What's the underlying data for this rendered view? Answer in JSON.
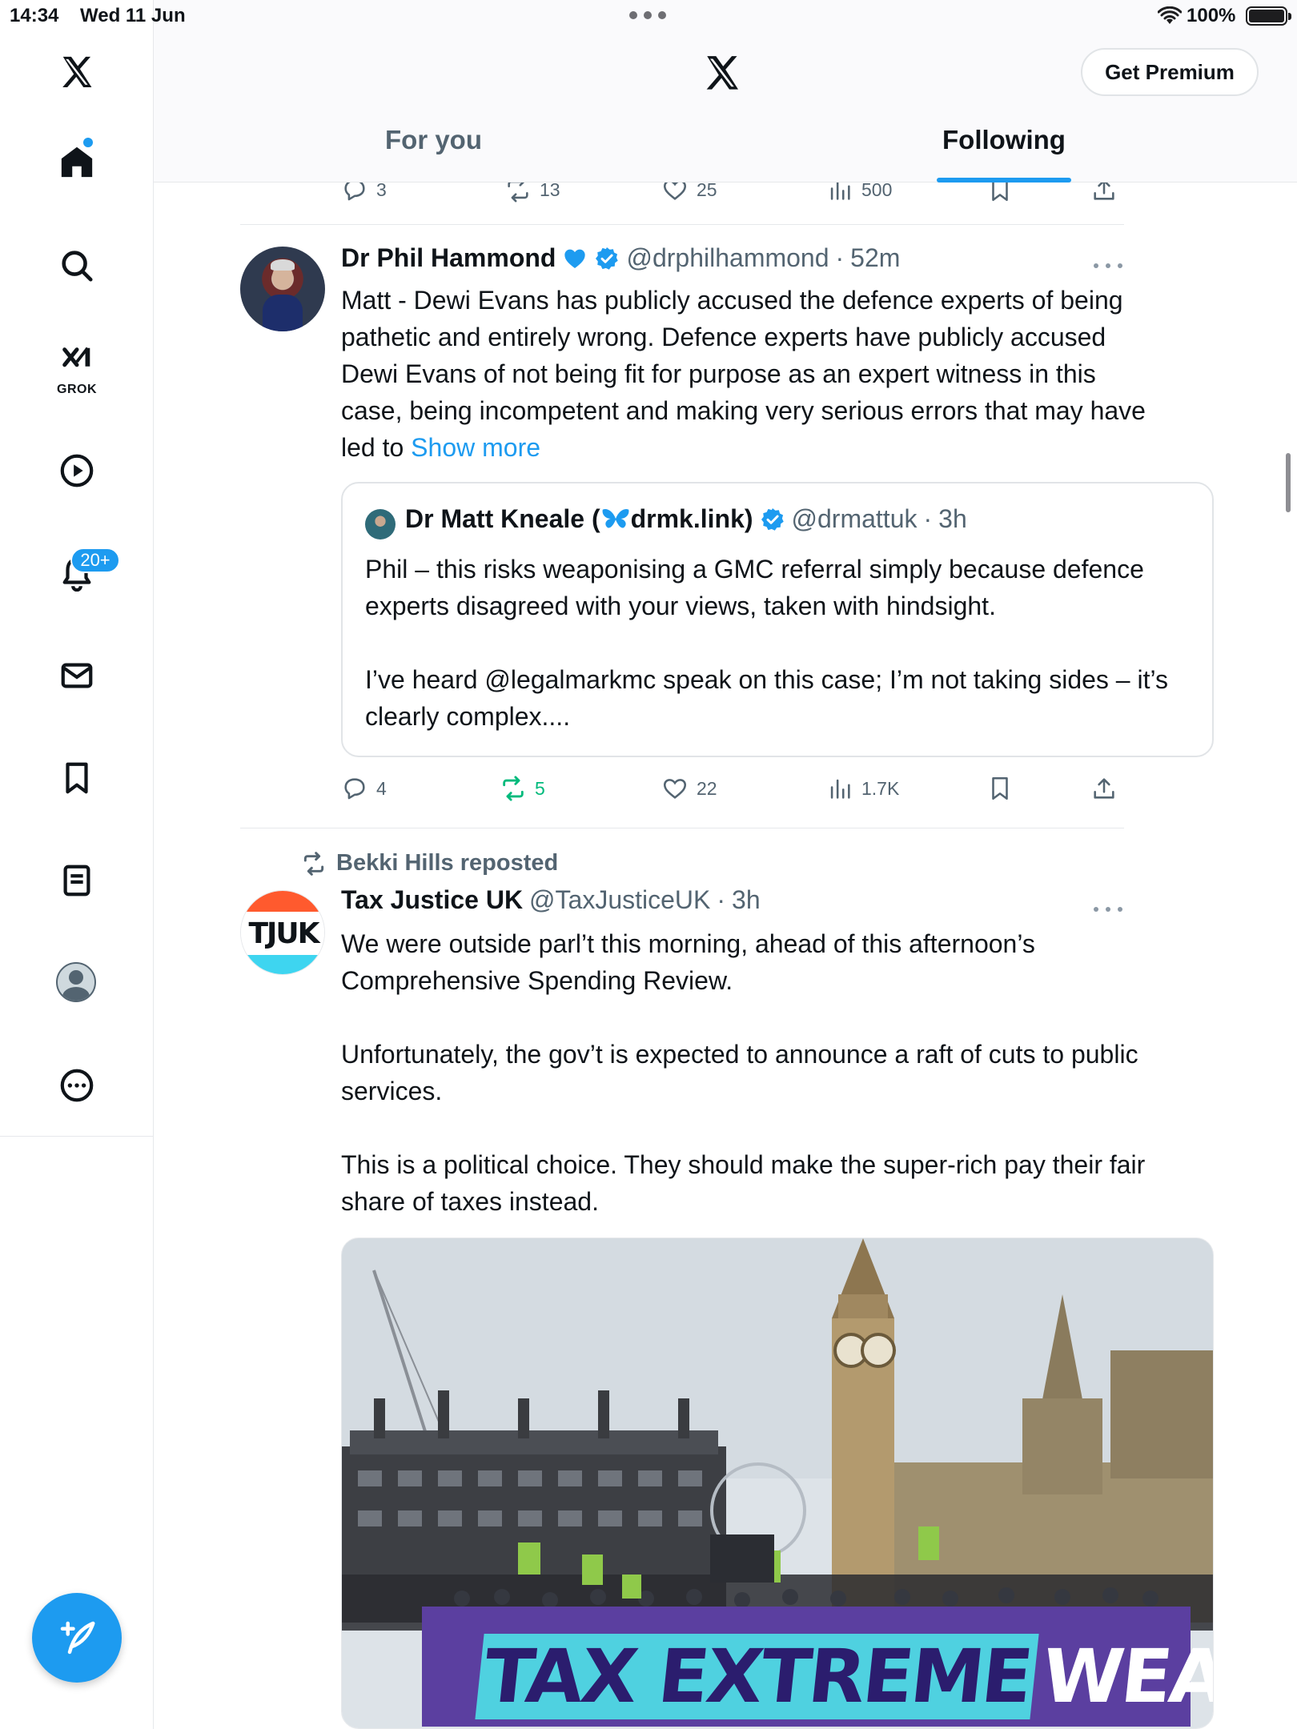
{
  "status_bar": {
    "time": "14:34",
    "date": "Wed 11 Jun",
    "battery_percent": "100%"
  },
  "header": {
    "premium_button": "Get Premium",
    "tabs": [
      {
        "label": "For you",
        "active": false
      },
      {
        "label": "Following",
        "active": true
      }
    ]
  },
  "sidebar": {
    "items": [
      {
        "name": "home",
        "icon": "home-icon"
      },
      {
        "name": "explore",
        "icon": "search-icon"
      },
      {
        "name": "grok",
        "icon": "grok-icon",
        "label": "GROK"
      },
      {
        "name": "videos",
        "icon": "play-icon"
      },
      {
        "name": "notifications",
        "icon": "bell-icon",
        "badge": "20+"
      },
      {
        "name": "messages",
        "icon": "mail-icon"
      },
      {
        "name": "bookmarks",
        "icon": "bookmark-icon"
      },
      {
        "name": "lists",
        "icon": "list-icon"
      },
      {
        "name": "profile",
        "icon": "avatar"
      },
      {
        "name": "more",
        "icon": "more-icon"
      }
    ],
    "compose": "compose-icon"
  },
  "feed": {
    "partial_post_actions": {
      "replies": "3",
      "reposts": "13",
      "likes": "25",
      "views": "500"
    },
    "posts": [
      {
        "name": "Dr Phil Hammond",
        "handle": "@drphilhammond",
        "time": "52m",
        "text": "Matt - Dewi Evans has publicly accused the defence experts of being pathetic and entirely wrong. Defence experts have publicly accused Dewi Evans of not being fit for purpose as an expert witness in this case, being incompetent and making very serious errors that may have led to ",
        "show_more": "Show more",
        "quote": {
          "name_part1": "Dr Matt Kneale (",
          "name_part2": "drmk.link)",
          "handle": "@drmattuk",
          "time": "3h",
          "text": "Phil – this risks weaponising a GMC referral simply because defence experts disagreed with your views, taken with hindsight.\n\nI’ve heard @legalmarkmc speak on this case; I’m not taking sides – it’s clearly complex...."
        },
        "actions": {
          "replies": "4",
          "reposts": "5",
          "likes": "22",
          "views": "1.7K"
        }
      },
      {
        "reposted_by": "Bekki Hills reposted",
        "name": "Tax Justice UK",
        "handle": "@TaxJusticeUK",
        "time": "3h",
        "avatar_text": "TJUK",
        "text": "We were outside parl’t this morning, ahead of this afternoon’s Comprehensive Spending Review.\n\nUnfortunately, the gov’t is expected to announce a raft of cuts to public services.\n\nThis is a political choice. They should make the super-rich pay their fair share of taxes instead.",
        "banner": {
          "word1": "TAX EXTREME",
          "word2": "WEALTH"
        }
      }
    ]
  },
  "colors": {
    "accent": "#1d9bf0",
    "secondary_text": "#536471",
    "repost_green": "#00ba7c"
  }
}
